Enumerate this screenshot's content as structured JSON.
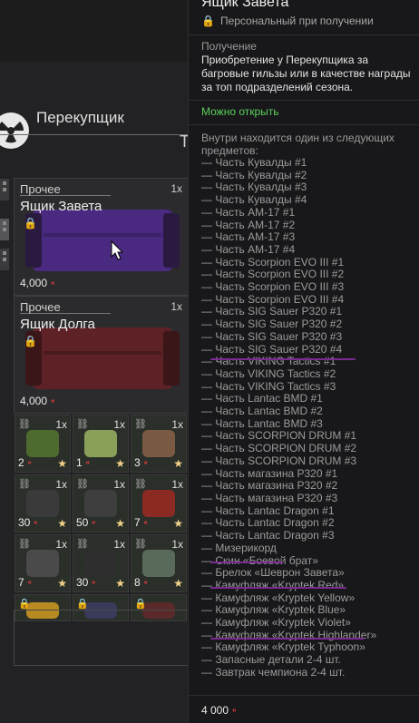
{
  "shop": {
    "header_letter": "Т",
    "vendor_name": "Перекупщик",
    "cards": [
      {
        "category": "Прочее",
        "qty": "1x",
        "name": "Ящик Завета",
        "price": "4,000",
        "color": "#5a2f9a"
      },
      {
        "category": "Прочее",
        "qty": "1x",
        "name": "Ящик Долга",
        "price": "4,000",
        "color": "#7a2a2e"
      }
    ],
    "grid": [
      {
        "qty": "1x",
        "price": "2",
        "icon": "ore-icon",
        "color": "#4f6a2e",
        "locked": false
      },
      {
        "qty": "1x",
        "price": "1",
        "icon": "slime-icon",
        "color": "#8aa05a",
        "locked": false
      },
      {
        "qty": "1x",
        "price": "3",
        "icon": "figure-icon",
        "color": "#7a5a42",
        "locked": false
      },
      {
        "qty": "1x",
        "price": "30",
        "icon": "device-icon",
        "color": "#3a3a3a",
        "locked": false
      },
      {
        "qty": "1x",
        "price": "50",
        "icon": "device-icon",
        "color": "#3e3e3e",
        "locked": false
      },
      {
        "qty": "1x",
        "price": "7",
        "icon": "crystal-icon",
        "color": "#8a2a22",
        "locked": false
      },
      {
        "qty": "1x",
        "price": "7",
        "icon": "robot-icon",
        "color": "#4a4a4a",
        "locked": false
      },
      {
        "qty": "1x",
        "price": "30",
        "icon": "case-icon",
        "color": "#2e2e2e",
        "locked": false
      },
      {
        "qty": "1x",
        "price": "8",
        "icon": "blob-icon",
        "color": "#5a6a5a",
        "locked": false
      },
      {
        "qty": "",
        "price": "",
        "icon": "crate-icon",
        "color": "#b88a22",
        "locked": true
      },
      {
        "qty": "",
        "price": "",
        "icon": "item-icon",
        "color": "#3a3a5a",
        "locked": true
      },
      {
        "qty": "",
        "price": "",
        "icon": "item-icon",
        "color": "#5a2a2a",
        "locked": true
      }
    ]
  },
  "tooltip": {
    "title": "Ящик Завета",
    "subtitle": "Персональный при получении",
    "obtain_label": "Получение",
    "obtain_text": "Приобретение у Перекупщика за багровые гильзы или в качестве награды за топ подразделений сезона.",
    "can_open": "Можно открыть",
    "contents_label": "Внутри находится один из следующих предметов:",
    "items": [
      "— Часть Кувалды #1",
      "— Часть Кувалды #2",
      "— Часть Кувалды #3",
      "— Часть Кувалды #4",
      "— Часть AM-17 #1",
      "— Часть AM-17 #2",
      "— Часть AM-17 #3",
      "— Часть AM-17 #4",
      "— Часть Scorpion EVO III #1",
      "— Часть Scorpion EVO III #2",
      "— Часть Scorpion EVO III #3",
      "— Часть Scorpion EVO III #4",
      "— Часть SIG Sauer P320 #1",
      "— Часть SIG Sauer P320 #2",
      "— Часть SIG Sauer P320 #3",
      "— Часть SIG Sauer P320 #4",
      "— Часть VIKING Tactics #1",
      "— Часть VIKING Tactics #2",
      "— Часть VIKING Tactics #3",
      "— Часть Lantac BMD #1",
      "— Часть Lantac BMD #2",
      "— Часть Lantac BMD #3",
      "— Часть SCORPION DRUM #1",
      "— Часть SCORPION DRUM #2",
      "— Часть SCORPION DRUM #3",
      "— Часть магазина P320 #1",
      "— Часть магазина P320 #2",
      "— Часть магазина P320 #3",
      "— Часть Lantac Dragon #1",
      "— Часть Lantac Dragon #2",
      "— Часть Lantac Dragon #3",
      "— Мизерикорд",
      "— Скин «Боевой брат»",
      "— Брелок «Шеврон Завета»",
      "— Камуфляж «Kryptek Red»",
      "— Камуфляж «Kryptek Yellow»",
      "— Камуфляж «Kryptek Blue»",
      "— Камуфляж «Kryptek Violet»",
      "— Камуфляж «Kryptek Highlander»",
      "— Камуфляж «Kryptek Typhoon»",
      "— Запасные детали 2-4 шт.",
      "— Завтрак чемпиона 2-4 шт."
    ],
    "price": "4 000"
  },
  "colors": {
    "accent_green": "#5bd05b",
    "currency_red": "#d23a3a",
    "star": "#f3d38a",
    "marker": "#7a2a90"
  }
}
